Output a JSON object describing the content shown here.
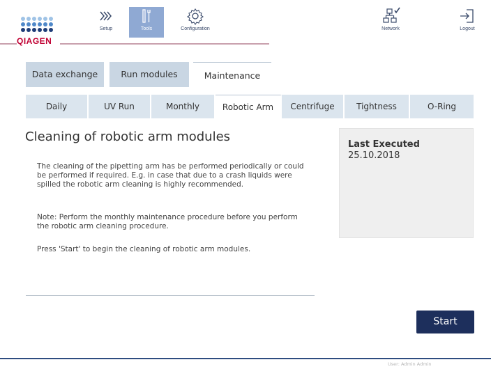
{
  "brand": {
    "logo_text": "QIAGEN",
    "color": "#c00033"
  },
  "nav": {
    "setup_label": "Setup",
    "tools_label": "Tools",
    "configuration_label": "Configuration",
    "network_label": "Network",
    "logout_label": "Logout",
    "active": "Tools"
  },
  "tabs": [
    {
      "label": "Data exchange",
      "active": false
    },
    {
      "label": "Run modules",
      "active": false
    },
    {
      "label": "Maintenance",
      "active": true
    }
  ],
  "subtabs": [
    {
      "label": "Daily",
      "active": false
    },
    {
      "label": "UV Run",
      "active": false
    },
    {
      "label": "Monthly",
      "active": false
    },
    {
      "label": "Robotic Arm",
      "active": true
    },
    {
      "label": "Centrifuge",
      "active": false
    },
    {
      "label": "Tightness",
      "active": false
    },
    {
      "label": "O-Ring",
      "active": false
    }
  ],
  "content": {
    "title": "Cleaning of robotic arm modules",
    "paragraph1": "The cleaning of the pipetting arm has be performed periodically or could be performed if required. E.g. in case that due to a crash liquids were spilled the robotic arm cleaning is highly recommended.",
    "paragraph2": "Note: Perform the monthly maintenance procedure before you perform the robotic arm cleaning procedure.",
    "paragraph3": "Press 'Start' to begin the cleaning of robotic arm modules."
  },
  "panel": {
    "heading": "Last Executed",
    "date": "25.10.2018"
  },
  "actions": {
    "start_label": "Start"
  },
  "footer": {
    "user_text": "User: Admin Admin"
  },
  "colors": {
    "accent": "#1d2f5c",
    "tab_inactive": "#c9d6e3",
    "tools_active": "#8fa9d3"
  }
}
